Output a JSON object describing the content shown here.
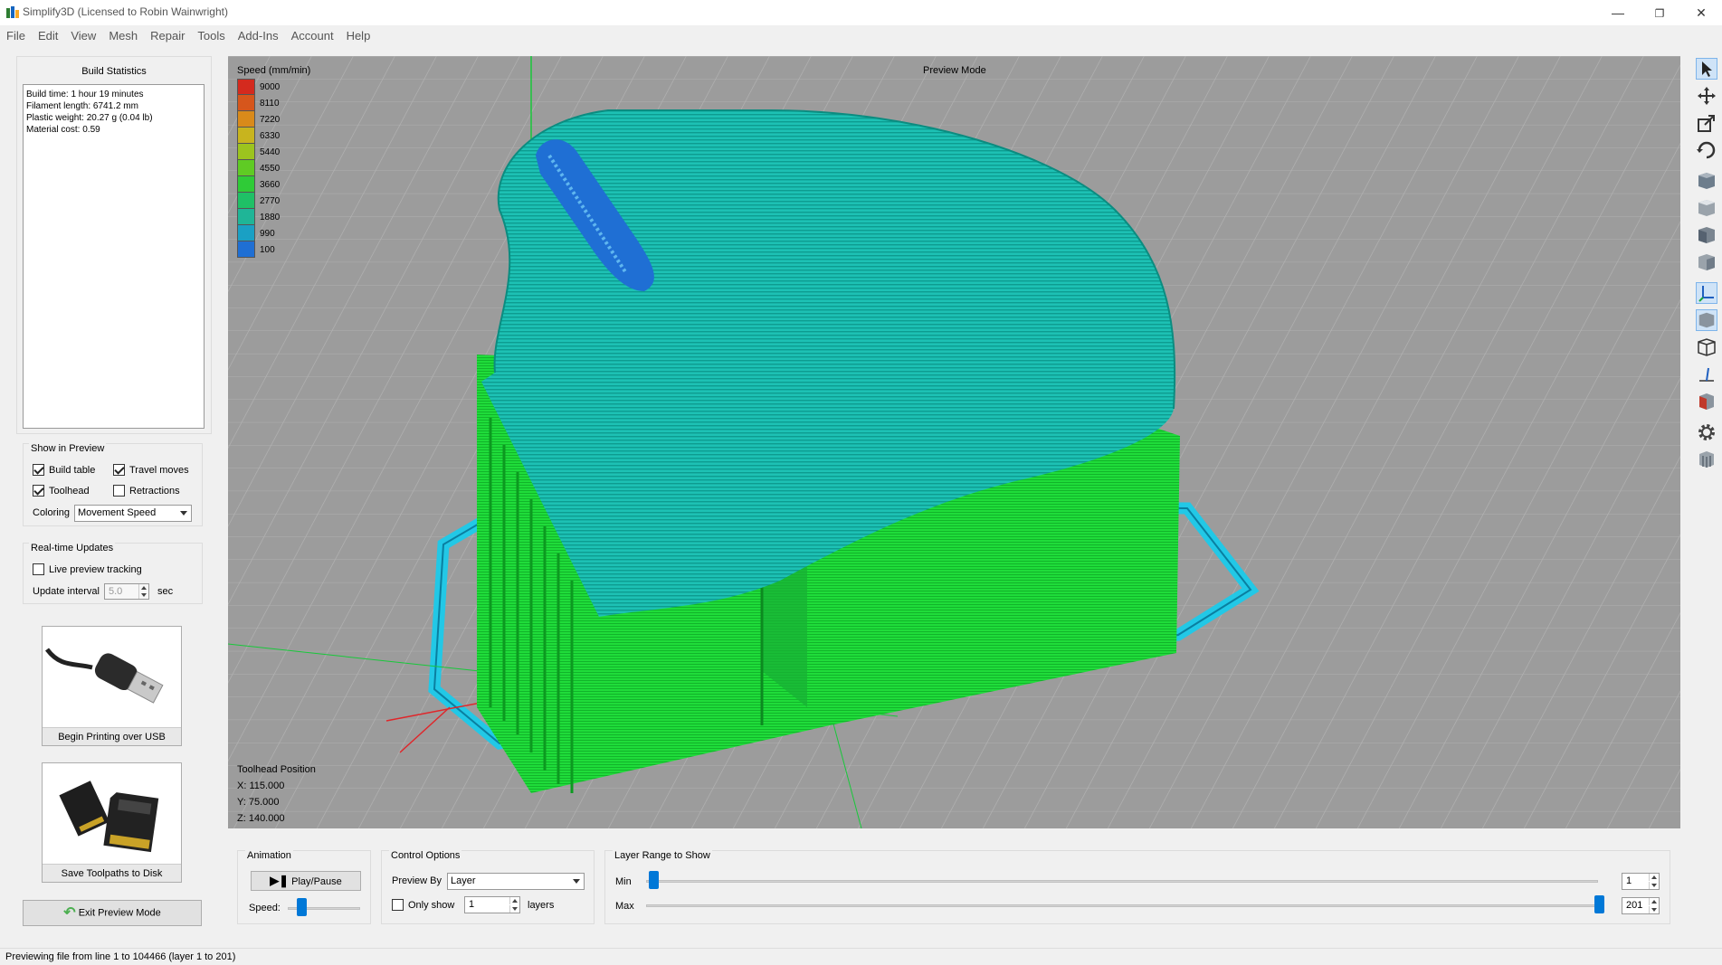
{
  "window": {
    "title": "Simplify3D (Licensed to Robin Wainwright)",
    "controls": [
      "minimize-icon",
      "restore-icon",
      "close-icon"
    ]
  },
  "menu": [
    "File",
    "Edit",
    "View",
    "Mesh",
    "Repair",
    "Tools",
    "Add-Ins",
    "Account",
    "Help"
  ],
  "build_stats": {
    "title": "Build Statistics",
    "lines": [
      "Build time: 1 hour 19 minutes",
      "Filament length: 6741.2 mm",
      "Plastic weight: 20.27 g (0.04 lb)",
      "Material cost: 0.59"
    ]
  },
  "show_in_preview": {
    "title": "Show in Preview",
    "build_table": {
      "label": "Build table",
      "checked": true
    },
    "travel_moves": {
      "label": "Travel moves",
      "checked": true
    },
    "toolhead": {
      "label": "Toolhead",
      "checked": true
    },
    "retractions": {
      "label": "Retractions",
      "checked": false
    },
    "coloring_label": "Coloring",
    "coloring_value": "Movement Speed"
  },
  "realtime": {
    "title": "Real-time Updates",
    "live_tracking": {
      "label": "Live preview tracking",
      "checked": false
    },
    "interval_label": "Update interval",
    "interval_value": "5.0",
    "interval_unit": "sec"
  },
  "actions": {
    "usb_label": "Begin Printing over USB",
    "sd_label": "Save Toolpaths to Disk",
    "exit_label": "Exit Preview Mode"
  },
  "viewport": {
    "mode_label": "Preview Mode",
    "legend_title": "Speed (mm/min)",
    "legend": [
      {
        "value": "9000",
        "color": "#d42a1e"
      },
      {
        "value": "8110",
        "color": "#d6561c"
      },
      {
        "value": "7220",
        "color": "#d98a1a"
      },
      {
        "value": "6330",
        "color": "#c8b41e"
      },
      {
        "value": "5440",
        "color": "#9cc41e"
      },
      {
        "value": "4550",
        "color": "#5fcb24"
      },
      {
        "value": "3660",
        "color": "#2fcb37"
      },
      {
        "value": "2770",
        "color": "#1fc066"
      },
      {
        "value": "1880",
        "color": "#1fb597"
      },
      {
        "value": "990",
        "color": "#1aa0c4"
      },
      {
        "value": "100",
        "color": "#1f6fd4"
      }
    ],
    "toolhead_title": "Toolhead Position",
    "x": "X: 115.000",
    "y": "Y: 75.000",
    "z": "Z: 140.000"
  },
  "animation": {
    "title": "Animation",
    "play_label": "Play/Pause",
    "speed_label": "Speed:",
    "speed_level": 0.12
  },
  "control_options": {
    "title": "Control Options",
    "preview_by_label": "Preview By",
    "preview_by_value": "Layer",
    "only_show_label": "Only show",
    "only_show_checked": false,
    "only_show_value": "1",
    "layers_label": "layers"
  },
  "layer_range": {
    "title": "Layer Range to Show",
    "min_label": "Min",
    "max_label": "Max",
    "min_value": "1",
    "max_value": "201",
    "total_layers": 201
  },
  "status": "Previewing file from line 1 to 104466 (layer 1 to 201)"
}
